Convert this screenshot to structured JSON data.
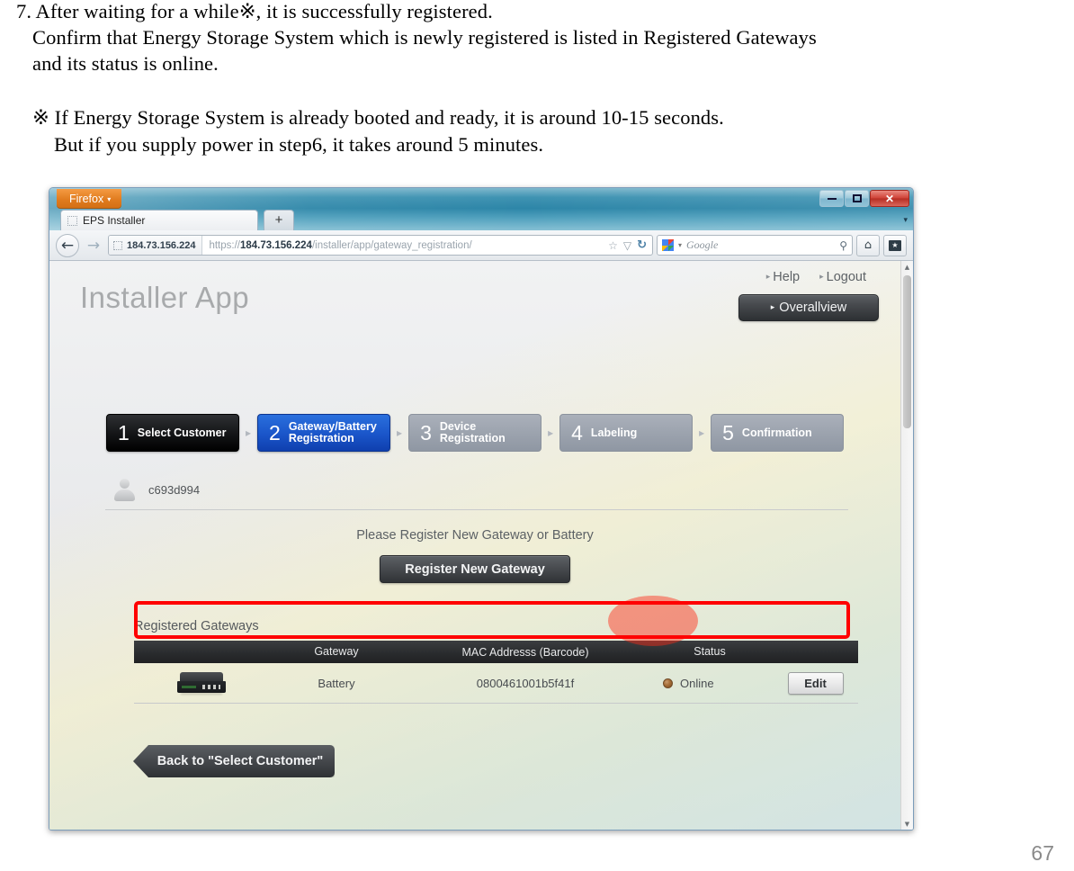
{
  "document": {
    "lines": [
      "7.  After waiting for a while※, it is successfully registered.",
      "Confirm that Energy Storage System which is newly registered is listed in Registered Gateways",
      "and its status is online.",
      "※ If Energy Storage System is already booted and ready, it is around 10-15 seconds.",
      "But if you supply power in step6, it takes around 5 minutes."
    ],
    "page_number": "67"
  },
  "browser": {
    "menu_button": "Firefox",
    "menu_caret": "▾",
    "tab_title": "EPS Installer",
    "new_tab": "+",
    "list_all_tabs": "▾",
    "window_controls": {
      "minimize": "–",
      "maximize": "□",
      "close": "✕"
    },
    "back": "←",
    "forward": "→",
    "identity_label": "184.73.156.224",
    "url_scheme": "https://",
    "url_host": "184.73.156.224",
    "url_path": "/installer/app/gateway_registration/",
    "bookmark_star": "☆",
    "dropmarker": "▽",
    "reload": "↻",
    "search_engine": "Google",
    "search_caret": "▾",
    "search_magnifier": "⚲",
    "home": "⌂",
    "bookmarks_star": "★",
    "bookmarks_caret": "▾",
    "scroll_up": "▲",
    "scroll_down": "▼"
  },
  "app": {
    "title": "Installer App",
    "links": [
      {
        "label": "Help",
        "arrow": "▸"
      },
      {
        "label": "Logout",
        "arrow": "▸"
      }
    ],
    "overallview": {
      "label": "Overallview",
      "arrow": "▸"
    },
    "steps": [
      {
        "num": "1",
        "label": "Select Customer",
        "state": "done"
      },
      {
        "num": "2",
        "label": "Gateway/Battery\nRegistration",
        "state": "active"
      },
      {
        "num": "3",
        "label": "Device\nRegistration",
        "state": "todo"
      },
      {
        "num": "4",
        "label": "Labeling",
        "state": "todo"
      },
      {
        "num": "5",
        "label": "Confirmation",
        "state": "todo"
      }
    ],
    "step_separator": "▸",
    "user": "c693d994",
    "register_prompt": "Please Register New Gateway or Battery",
    "register_button": "Register New Gateway",
    "table_title": "Registered Gateways",
    "table_headers": [
      "Gateway",
      "MAC Addresss (Barcode)",
      "Status"
    ],
    "rows": [
      {
        "device": "Battery",
        "mac": "0800461001b5f41f",
        "status": "Online",
        "edit": "Edit"
      }
    ],
    "back_button": "Back to \"Select Customer\""
  },
  "colors": {
    "step_done": "#000000",
    "step_active": "#1a55c9",
    "step_todo": "#9ba2ad",
    "annotation": "#ff0000",
    "firefox_orange": "#e07b1e"
  }
}
